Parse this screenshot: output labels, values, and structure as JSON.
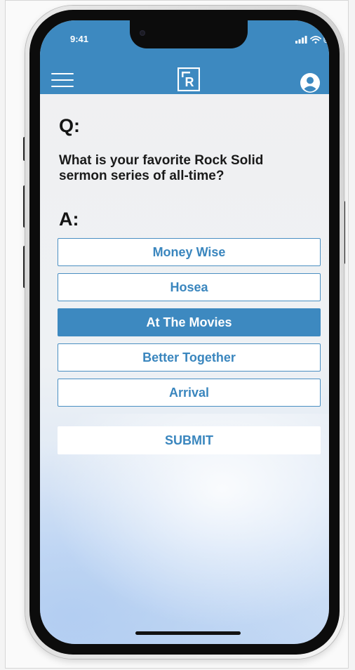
{
  "status_bar": {
    "time": "9:41",
    "icons": [
      "signal-icon",
      "wifi-icon",
      "battery-icon"
    ]
  },
  "header": {
    "logo_letter": "R",
    "background_color": "#3d89c0",
    "icons": [
      "hamburger-menu-icon",
      "logo-icon",
      "profile-icon"
    ]
  },
  "poll": {
    "q_label": "Q:",
    "question": "What is your favorite Rock Solid sermon series of all-time?",
    "a_label": "A:",
    "options": [
      {
        "label": "Money Wise",
        "selected": false
      },
      {
        "label": "Hosea",
        "selected": false
      },
      {
        "label": "At The Movies",
        "selected": true
      },
      {
        "label": "Better Together",
        "selected": false
      },
      {
        "label": "Arrival",
        "selected": false
      }
    ],
    "submit_label": "SUBMIT"
  },
  "colors": {
    "accent": "#3d89c0",
    "text": "#141414"
  }
}
